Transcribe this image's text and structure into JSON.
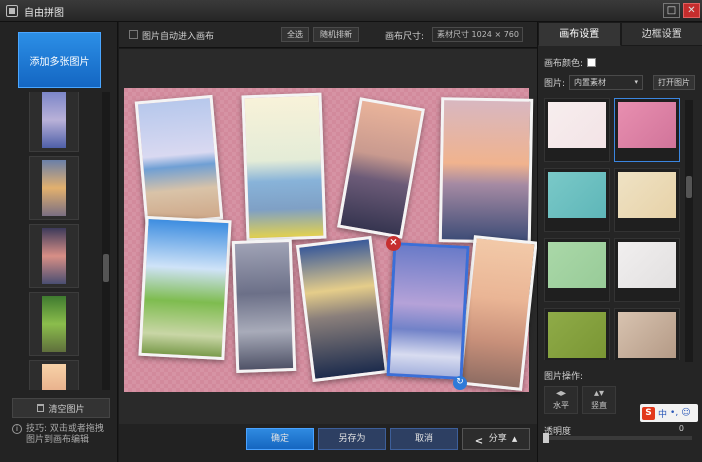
{
  "window": {
    "title": "自由拼图",
    "max_symbol": "□",
    "close_symbol": "✕"
  },
  "left": {
    "add_button": "添加多张图片",
    "thumbnails": [
      {
        "name": "sea-waves",
        "colors": [
          "#7c86c8",
          "#b9b1d8",
          "#4e5fa8"
        ]
      },
      {
        "name": "pier-sunset",
        "colors": [
          "#6a7fa8",
          "#e2b06e",
          "#7a6f82"
        ]
      },
      {
        "name": "pink-sea",
        "colors": [
          "#3c3a5a",
          "#d88f86",
          "#4a4e72"
        ]
      },
      {
        "name": "forest-path",
        "colors": [
          "#3f7a2f",
          "#8bbd4c",
          "#5f6f3c"
        ]
      },
      {
        "name": "sunset-clouds",
        "colors": [
          "#f7d2a8",
          "#e8b08c",
          "#d89a78"
        ]
      }
    ],
    "clear_button": "清空图片",
    "tip_icon": "i",
    "tip": "技巧: 双击或者拖拽图片到画布编辑"
  },
  "toolbar": {
    "auto_enter_label": "图片自动进入画布",
    "select_all": "全选",
    "random_arrange": "随机排新",
    "canvas_size_label": "画布尺寸:",
    "canvas_size_value": "素材尺寸 1024 × 760"
  },
  "canvas": {
    "photos": [
      "beach",
      "girl-with-pinwheel",
      "pier",
      "sunset-sea",
      "green-field",
      "tree",
      "people-sunset",
      "waves",
      "feather"
    ],
    "delete_symbol": "×",
    "rotate_symbol": "↻"
  },
  "bottom": {
    "confirm": "确定",
    "save_as": "另存为",
    "cancel": "取消",
    "share": "分享",
    "share_chevron": "▲"
  },
  "right": {
    "tabs": [
      "画布设置",
      "边框设置"
    ],
    "active_tab": 0,
    "canvas_color_label": "画布颜色:",
    "canvas_color": "#ffffff",
    "image_label": "图片:",
    "image_source": "内置素材",
    "select_arrow": "▾",
    "open_image": "打开图片",
    "backgrounds": [
      {
        "name": "white-tree",
        "colors": [
          "#f7eeee",
          "#f3e3e6"
        ],
        "selected": false
      },
      {
        "name": "pink-box",
        "colors": [
          "#e88fb0",
          "#d1749a"
        ],
        "selected": true
      },
      {
        "name": "teal-girl",
        "colors": [
          "#7ac9c8",
          "#5eb6b8"
        ],
        "selected": false
      },
      {
        "name": "cream-leaves",
        "colors": [
          "#efe2c4",
          "#e7d2a8"
        ],
        "selected": false
      },
      {
        "name": "mint-dots",
        "colors": [
          "#aad8a8",
          "#98cb98"
        ],
        "selected": false
      },
      {
        "name": "white-pattern",
        "colors": [
          "#f1efef",
          "#e2e0e0"
        ],
        "selected": false
      },
      {
        "name": "olive-green",
        "colors": [
          "#8fab48",
          "#7a9634"
        ],
        "selected": false
      },
      {
        "name": "love-heart",
        "colors": [
          "#d8c3b0",
          "#b49a86"
        ],
        "selected": false
      }
    ],
    "ops_label": "图片操作:",
    "flip_h": "水平",
    "flip_h_glyph": "◂▸",
    "flip_v": "竖直",
    "flip_v_glyph": "▴▾",
    "ime_logo": "S",
    "ime_chinese": "中",
    "ime_punct": "•,",
    "ime_emoji": "☺",
    "opacity_label": "透明度",
    "opacity_value": "0"
  }
}
